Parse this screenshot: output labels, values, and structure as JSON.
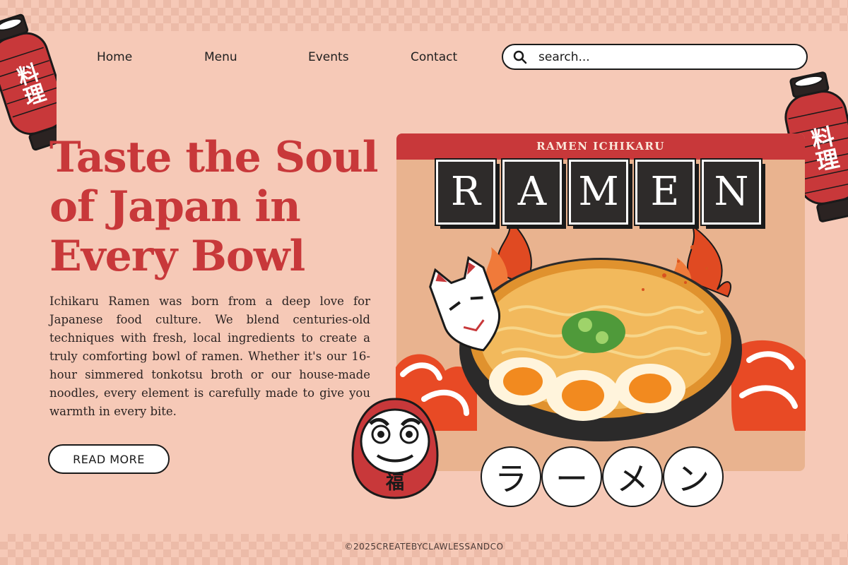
{
  "nav": {
    "items": [
      "Home",
      "Menu",
      "Events",
      "Contact"
    ],
    "search_placeholder": "search..."
  },
  "hero": {
    "headline_lines": [
      "Taste the Soul",
      "of Japan in",
      "Every Bowl"
    ],
    "body": "Ichikaru Ramen was born from a deep love for Japanese food culture. We blend centuries-old techniques with fresh, local ingredients to create a truly comforting bowl of ramen. Whether it's our 16-hour simmered tonkotsu broth or our house-made noodles, every element is carefully made to give you warmth in every bite.",
    "cta_label": "READ MORE"
  },
  "poster": {
    "banner": "RAMEN ICHIKARU",
    "tiles": [
      "R",
      "A",
      "M",
      "E",
      "N"
    ],
    "katakana": [
      "ラ",
      "ー",
      "メ",
      "ン"
    ],
    "lantern_text": "料理",
    "daruma_text": "福"
  },
  "footer": {
    "copyright": "©2025CREATEBYCLAWLESSANDCO"
  },
  "colors": {
    "background": "#f6c9b7",
    "accent_red": "#c8383a",
    "tile_dark": "#2e2b2a",
    "card_bg": "#e9b38f"
  }
}
